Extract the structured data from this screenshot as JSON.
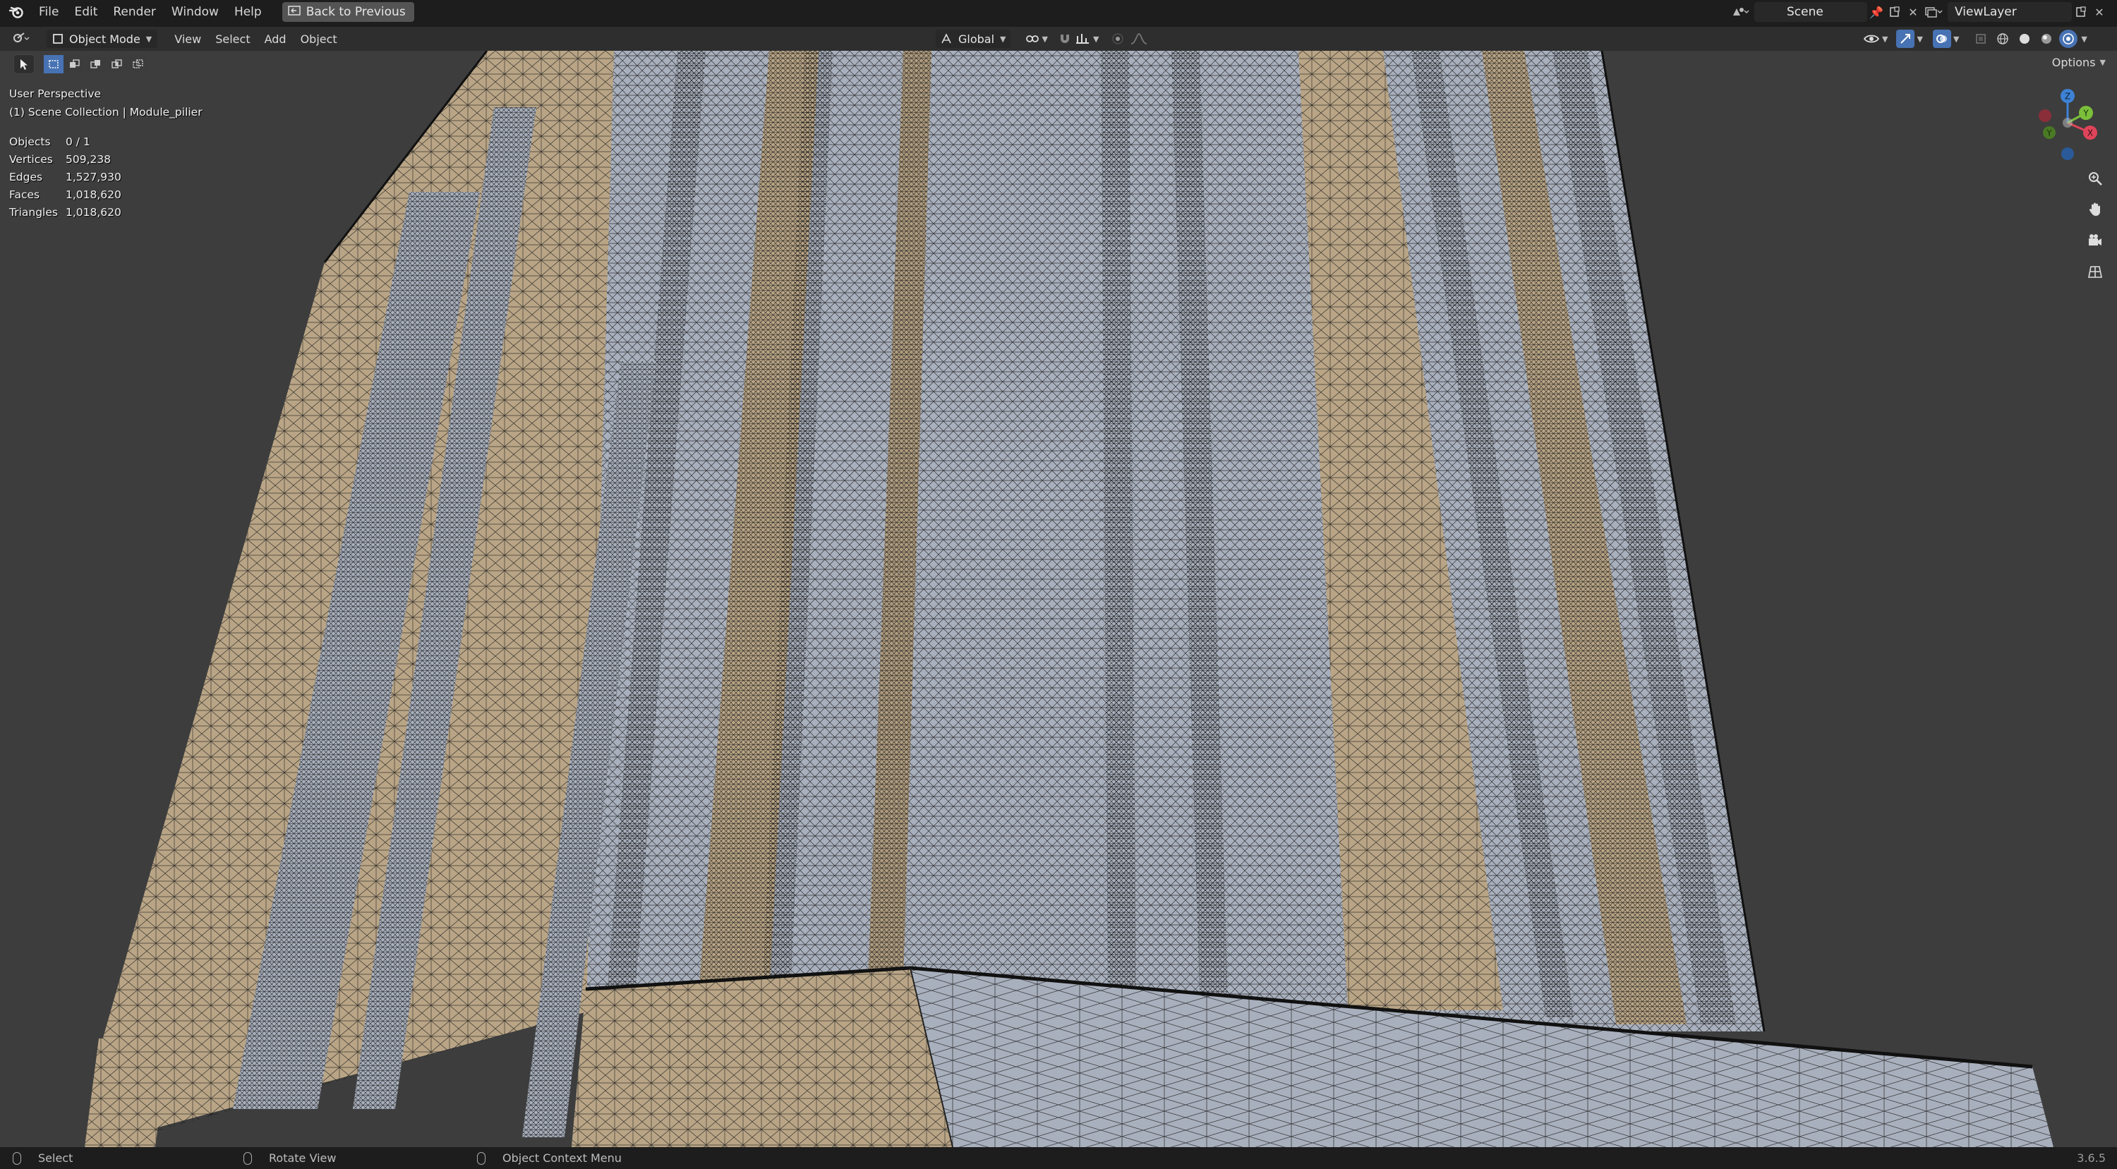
{
  "menubar": {
    "items": [
      "File",
      "Edit",
      "Render",
      "Window",
      "Help"
    ],
    "back_button": "Back to Previous",
    "scene_name": "Scene",
    "view_layer": "ViewLayer"
  },
  "header": {
    "mode": "Object Mode",
    "menus": [
      "View",
      "Select",
      "Add",
      "Object"
    ],
    "transform_orientation": "Global",
    "options_label": "Options"
  },
  "viewport": {
    "perspective": "User Perspective",
    "collection": "(1) Scene Collection | Module_pilier",
    "stats": [
      {
        "label": "Objects",
        "value": "0 / 1"
      },
      {
        "label": "Vertices",
        "value": "509,238"
      },
      {
        "label": "Edges",
        "value": "1,527,930"
      },
      {
        "label": "Faces",
        "value": "1,018,620"
      },
      {
        "label": "Triangles",
        "value": "1,018,620"
      }
    ],
    "gizmo_axes": {
      "z": "Z",
      "x": "X",
      "y": "Y"
    }
  },
  "statusbar": {
    "left": "Select",
    "middle": "Rotate View",
    "right": "Object Context Menu",
    "version": "3.6.5"
  },
  "colors": {
    "background": "#3d3d3d",
    "ui_dark": "#1d1d1d",
    "header": "#303030",
    "accent_blue": "#4772b3",
    "mesh_tan": "#b9a586",
    "mesh_gray": "#a9b0bd",
    "axis_x": "#e0445a",
    "axis_y": "#7bbf3a",
    "axis_z": "#3d82d6"
  }
}
